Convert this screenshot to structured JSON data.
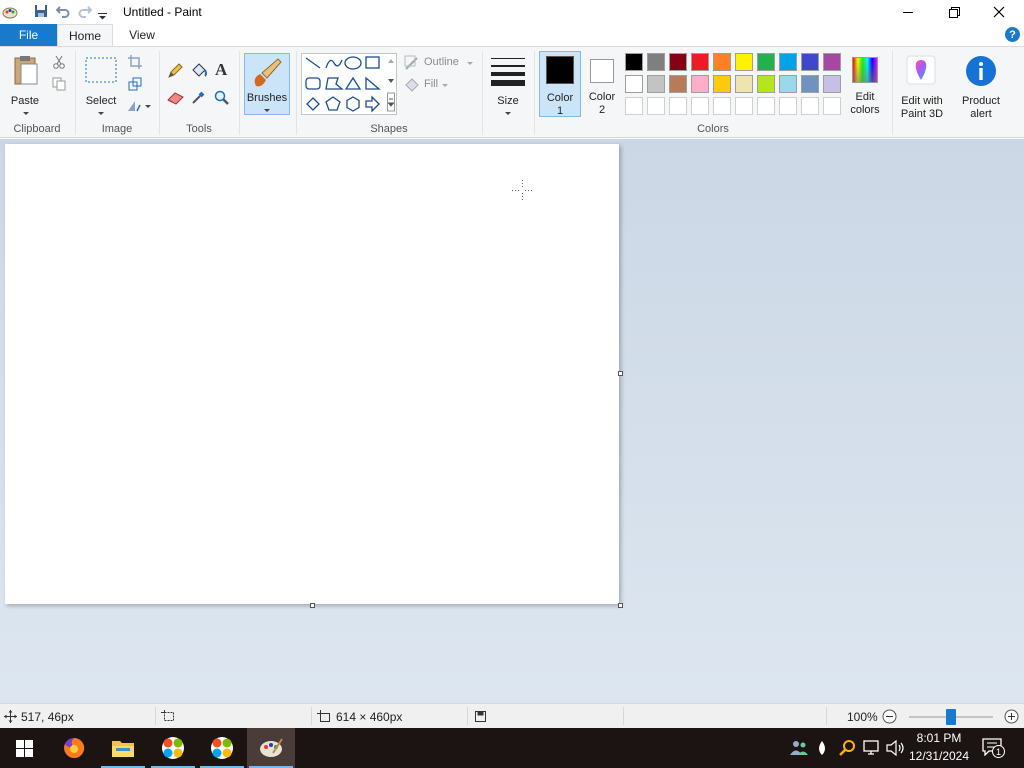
{
  "window": {
    "title": "Untitled - Paint",
    "controls": {
      "minimize": "—",
      "maximize": "❐",
      "close": "✕"
    }
  },
  "tabs": {
    "file": "File",
    "home": "Home",
    "view": "View",
    "help": "?"
  },
  "ribbon": {
    "clipboard": {
      "group": "Clipboard",
      "paste": "Paste"
    },
    "image": {
      "group": "Image",
      "select": "Select"
    },
    "tools": {
      "group": "Tools",
      "text_glyph": "A"
    },
    "brushes": {
      "label": "Brushes"
    },
    "shapes": {
      "group": "Shapes",
      "outline": "Outline",
      "fill": "Fill"
    },
    "size": {
      "label": "Size"
    },
    "colors": {
      "group": "Colors",
      "color1": {
        "line1": "Color",
        "line2": "1",
        "value": "#000000"
      },
      "color2": {
        "line1": "Color",
        "line2": "2",
        "value": "#ffffff"
      },
      "palette_row1": [
        "#000000",
        "#7f7f7f",
        "#880015",
        "#ed1c24",
        "#ff7f27",
        "#fff200",
        "#22b14c",
        "#00a2e8",
        "#3f48cc",
        "#a349a4"
      ],
      "palette_row2": [
        "#ffffff",
        "#c3c3c3",
        "#b97a57",
        "#ffaec9",
        "#ffc90e",
        "#efe4b0",
        "#b5e61d",
        "#99d9ea",
        "#7092be",
        "#c8bfe7"
      ],
      "palette_row3": [
        "#ffffff",
        "#ffffff",
        "#ffffff",
        "#ffffff",
        "#ffffff",
        "#ffffff",
        "#ffffff",
        "#ffffff",
        "#ffffff",
        "#ffffff"
      ],
      "edit_colors": {
        "line1": "Edit",
        "line2": "colors"
      }
    },
    "paint3d": {
      "line1": "Edit with",
      "line2": "Paint 3D"
    },
    "product_alert": {
      "line1": "Product",
      "line2": "alert"
    }
  },
  "status": {
    "cursor_pos": "517, 46px",
    "canvas_size": "614 × 460px",
    "zoom": "100%",
    "zoom_level": 100
  },
  "taskbar": {
    "time": "8:01 PM",
    "date": "12/31/2024",
    "notification_count": "1"
  }
}
